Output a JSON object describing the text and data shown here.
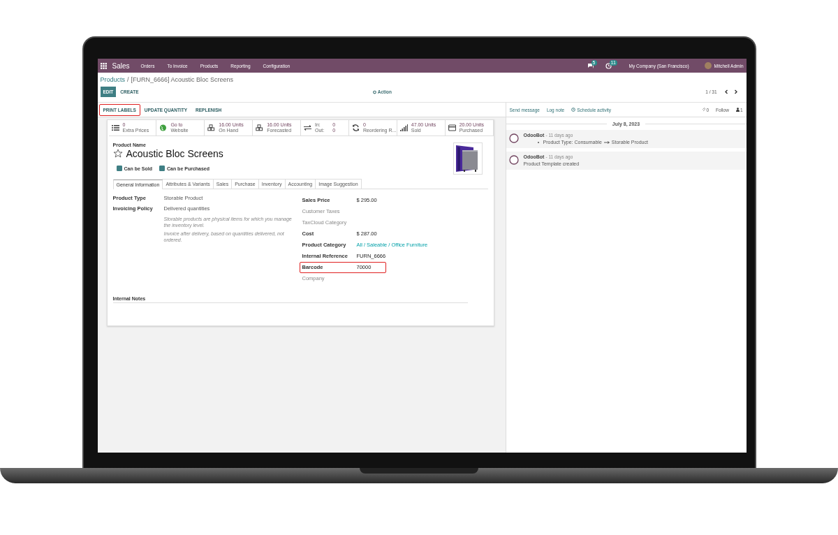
{
  "navbar": {
    "app_name": "Sales",
    "menu": [
      "Orders",
      "To Invoice",
      "Products",
      "Reporting",
      "Configuration"
    ],
    "messages_count": "5",
    "activities_count": "11",
    "company": "My Company (San Francisco)",
    "user": "Mitchell Admin"
  },
  "breadcrumb": {
    "parent": "Products",
    "separator": "/",
    "current": "[FURN_6666] Acoustic Bloc Screens"
  },
  "control_panel": {
    "edit": "EDIT",
    "create": "CREATE",
    "action": "Action",
    "pager": "1 / 31"
  },
  "header_buttons": [
    {
      "label": "PRINT LABELS",
      "highlighted": true
    },
    {
      "label": "UPDATE QUANTITY",
      "highlighted": false
    },
    {
      "label": "REPLENISH",
      "highlighted": false
    }
  ],
  "stat_buttons": [
    {
      "kind": "list",
      "value": "0",
      "label": "Extra Prices"
    },
    {
      "kind": "globe",
      "value": "Go to",
      "label": "Website"
    },
    {
      "kind": "cubes",
      "value": "16.00 Units",
      "label": "On Hand"
    },
    {
      "kind": "cubes",
      "value": "16.00 Units",
      "label": "Forecasted"
    },
    {
      "kind": "inout",
      "rows": [
        {
          "label": "In:",
          "value": "0"
        },
        {
          "label": "Out:",
          "value": "0"
        }
      ]
    },
    {
      "kind": "refresh",
      "value": "0",
      "label": "Reordering R..."
    },
    {
      "kind": "signal",
      "value": "47.00 Units",
      "label": "Sold"
    },
    {
      "kind": "card",
      "value": "20.00 Units",
      "label": "Purchased"
    }
  ],
  "form": {
    "name_label": "Product Name",
    "name": "Acoustic Bloc Screens",
    "favorite": false,
    "image": {
      "kind": "picture"
    },
    "checkboxes": [
      {
        "label": "Can be Sold",
        "checked": true
      },
      {
        "label": "Can be Purchased",
        "checked": true
      }
    ],
    "tabs": [
      {
        "label": "General Information",
        "selected": true
      },
      {
        "label": "Attributes & Variants",
        "selected": false
      },
      {
        "label": "Sales",
        "selected": false
      },
      {
        "label": "Purchase",
        "selected": false
      },
      {
        "label": "Inventory",
        "selected": false
      },
      {
        "label": "Accounting",
        "selected": false
      },
      {
        "label": "Image Suggestion",
        "selected": false
      }
    ],
    "left_fields": [
      {
        "label": "Product Type",
        "value": "Storable Product"
      },
      {
        "label": "Invoicing Policy",
        "value": "Delivered quantities"
      }
    ],
    "help_texts": [
      "Storable products are physical items for which you manage the inventory level.",
      "Invoice after delivery, based on quantities delivered, not ordered."
    ],
    "right_fields": [
      {
        "label": "Sales Price",
        "value": "$ 295.00",
        "muted": false,
        "link": false,
        "highlighted": false
      },
      {
        "label": "Customer Taxes",
        "muted": true,
        "highlighted": false
      },
      {
        "label": "TaxCloud Category",
        "muted": true,
        "highlighted": false
      },
      {
        "label": "Cost",
        "value": "$ 287.00",
        "muted": false,
        "link": false,
        "highlighted": false
      },
      {
        "label": "Product Category",
        "value": "All / Saleable / Office Furniture",
        "muted": false,
        "link": true,
        "highlighted": false
      },
      {
        "label": "Internal Reference",
        "value": "FURN_6666",
        "muted": false,
        "link": false,
        "highlighted": false
      },
      {
        "label": "Barcode",
        "value": "70000",
        "muted": false,
        "link": false,
        "highlighted": true
      },
      {
        "label": "Company",
        "muted": true,
        "highlighted": false
      }
    ],
    "internal_notes_label": "Internal Notes"
  },
  "chatter": {
    "actions": [
      "Send message",
      "Log note",
      "Schedule activity"
    ],
    "attachments": "0",
    "follow": "Follow",
    "followers": "1",
    "date": "July 8, 2023",
    "messages": [
      {
        "kind": "tracking",
        "author": "OdooBot",
        "time": "- 11 days ago",
        "old_value": "Product Type: Consumable",
        "new_value": "Storable Product"
      },
      {
        "kind": "text",
        "author": "OdooBot",
        "time": "- 11 days ago",
        "body": "Product Template created"
      }
    ]
  }
}
